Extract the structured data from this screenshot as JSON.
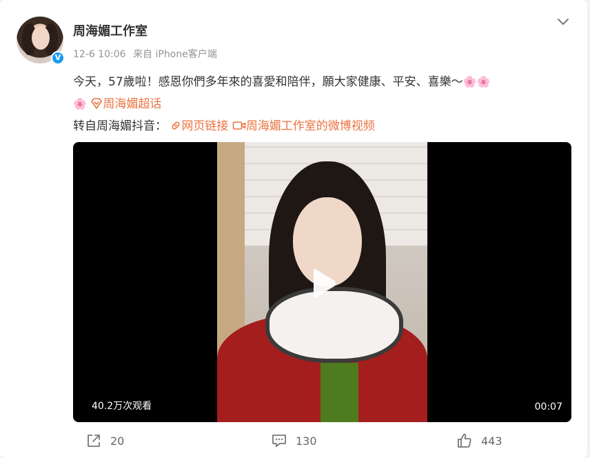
{
  "post": {
    "author": "周海媚工作室",
    "verified_mark": "V",
    "time": "12-6 10:06",
    "source": "来自 iPhone客户端",
    "text_main": "今天，57歲啦！感恩你們多年來的喜愛和陪伴，願大家健康、平安、喜樂～",
    "flower_emoji": "🌸🌸",
    "flower_emoji_single": "🌸",
    "supertopic_label": "周海媚超话",
    "repost_prefix": "转自周海媚抖音：",
    "web_link_label": "网页链接",
    "video_link_label": "周海媚工作室的微博视频"
  },
  "video": {
    "views": "40.2万次观看",
    "duration": "00:07"
  },
  "actions": {
    "share_count": "20",
    "comment_count": "130",
    "like_count": "443"
  },
  "colors": {
    "link": "#eb7340",
    "verified": "#1d9bf0",
    "text": "#333333",
    "meta": "#939393"
  },
  "icons": [
    "chevron-down-icon",
    "verified-icon",
    "link-icon",
    "video-icon",
    "supertopic-icon",
    "play-icon",
    "share-icon",
    "comment-icon",
    "like-icon"
  ]
}
